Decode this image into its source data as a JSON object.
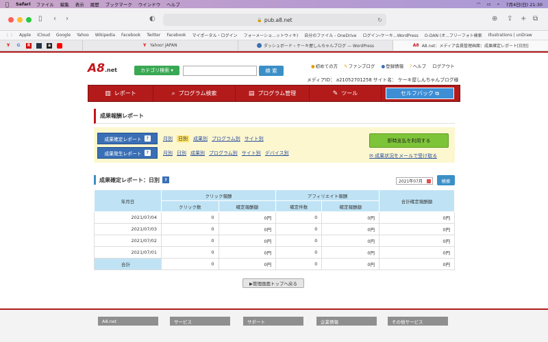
{
  "menubar": {
    "app": "Safari",
    "items": [
      "ファイル",
      "編集",
      "表示",
      "履歴",
      "ブックマーク",
      "ウインドウ",
      "ヘルプ"
    ],
    "datetime": "7月4日(日)  21:30"
  },
  "browser": {
    "url": "pub.a8.net",
    "favorites": [
      "Apple",
      "iCloud",
      "Google",
      "Yahoo",
      "Wikipedia",
      "Facebook",
      "Twitter",
      "Facebook",
      "マイポータル・ログイン",
      "フォーメーショ...ットウィキ)",
      "自分のファイル - OneDrive",
      "ログイン‹ケーキ...WordPress",
      "O-DAN (オ...フリーフォト検索",
      "Illustrations | unDraw"
    ],
    "tabs": [
      {
        "label": "Yahoo! JAPAN"
      },
      {
        "label": "ダッシュボード ‹ ケーキ屋しんちゃんブログ — WordPress"
      },
      {
        "label": "A8.net：メディア会員管理画面：成果確定レポート[日別]"
      }
    ]
  },
  "header": {
    "logo_text": "A8",
    "logo_suffix": ".net",
    "category_button": "カテゴリ検索",
    "search_button": "検 索",
    "links": [
      "初めての方",
      "ファンブログ",
      "登録情報",
      "ヘルプ",
      "ログアウト"
    ],
    "media_info": "メディアID： a21052701258 サイト名： ケーキ屋しんちゃんブログ様"
  },
  "nav": {
    "items": [
      "レポート",
      "プログラム検索",
      "プログラム管理",
      "ツール"
    ],
    "selfback": "セルフバック"
  },
  "section_title": "成果報酬レポート",
  "report_links": {
    "confirmed_label": "成果確定レポート",
    "confirmed": [
      "月別",
      "日別",
      "成果別",
      "プログラム別",
      "サイト別"
    ],
    "occurred_label": "成果発生レポート",
    "occurred": [
      "月別",
      "日別",
      "成果別",
      "プログラム別",
      "サイト別",
      "デバイス別"
    ],
    "instant_pay": "即時支払を利用する",
    "mail_link": "成果状況をメールで受け取る",
    "help": "?"
  },
  "daily": {
    "title": "成果確定レポート：日別",
    "help": "?",
    "month": "2021年07月",
    "search": "検索"
  },
  "table": {
    "h_date": "年月日",
    "h_click": "クリック報酬",
    "h_affiliate": "アフィリエイト報酬",
    "h_total": "合計確定報酬額",
    "h_clicks": "クリック数",
    "h_click_reward": "確定報酬額",
    "h_count": "確定件数",
    "h_aff_reward": "確定報酬額",
    "rows": [
      {
        "date": "2021/07/04",
        "clicks": "0",
        "click_reward": "0円",
        "count": "0",
        "aff_reward": "0円",
        "total": "0円"
      },
      {
        "date": "2021/07/03",
        "clicks": "0",
        "click_reward": "0円",
        "count": "0",
        "aff_reward": "0円",
        "total": "0円"
      },
      {
        "date": "2021/07/02",
        "clicks": "0",
        "click_reward": "0円",
        "count": "0",
        "aff_reward": "0円",
        "total": "0円"
      },
      {
        "date": "2021/07/01",
        "clicks": "0",
        "click_reward": "0円",
        "count": "0",
        "aff_reward": "0円",
        "total": "0円"
      }
    ],
    "sum": {
      "label": "合計",
      "clicks": "0",
      "click_reward": "0円",
      "count": "0",
      "aff_reward": "0円",
      "total": "0円"
    }
  },
  "back_button": "▶管理画面トップへ戻る",
  "footer": [
    "A8.net",
    "サービス",
    "サポート",
    "企業情報",
    "その他サービス"
  ]
}
